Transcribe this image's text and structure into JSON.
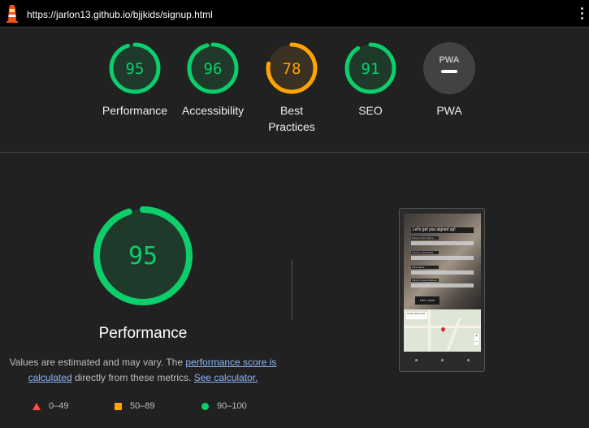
{
  "url": "https://jarlon13.github.io/bjjkids/signup.html",
  "colors": {
    "pass": "#0cce6b",
    "average": "#ffa400",
    "fail": "#ff4e42",
    "pass_bg": "#1f3a2a",
    "average_bg": "#3b3122"
  },
  "gauges": [
    {
      "score": "95",
      "label": "Performance",
      "fraction": 0.95,
      "rating": "pass"
    },
    {
      "score": "96",
      "label": "Accessibility",
      "fraction": 0.96,
      "rating": "pass"
    },
    {
      "score": "78",
      "label": "Best\nPractices",
      "fraction": 0.78,
      "rating": "average"
    },
    {
      "score": "91",
      "label": "SEO",
      "fraction": 0.91,
      "rating": "pass"
    },
    {
      "score": "",
      "label": "PWA",
      "badge": "PWA",
      "rating": "pwa"
    }
  ],
  "performance": {
    "score": "95",
    "fraction": 0.95,
    "title": "Performance",
    "note_prefix": "Values are estimated and may vary. The ",
    "note_link1": "performance score is calculated",
    "note_middle": " directly from these metrics. ",
    "note_link2": "See calculator."
  },
  "legend": [
    {
      "range": "0–49",
      "shape": "triangle"
    },
    {
      "range": "50–89",
      "shape": "square"
    },
    {
      "range": "90–100",
      "shape": "circle"
    }
  ],
  "thumbnail": {
    "heading": "Let's get you signed up!",
    "fields": [
      "Parent's First Name",
      "Parent's Last Name",
      "Kid's Name",
      "Parent's Email Address"
    ],
    "button": "Let's Jam!",
    "map_place": "Gracie Barra Kid"
  }
}
